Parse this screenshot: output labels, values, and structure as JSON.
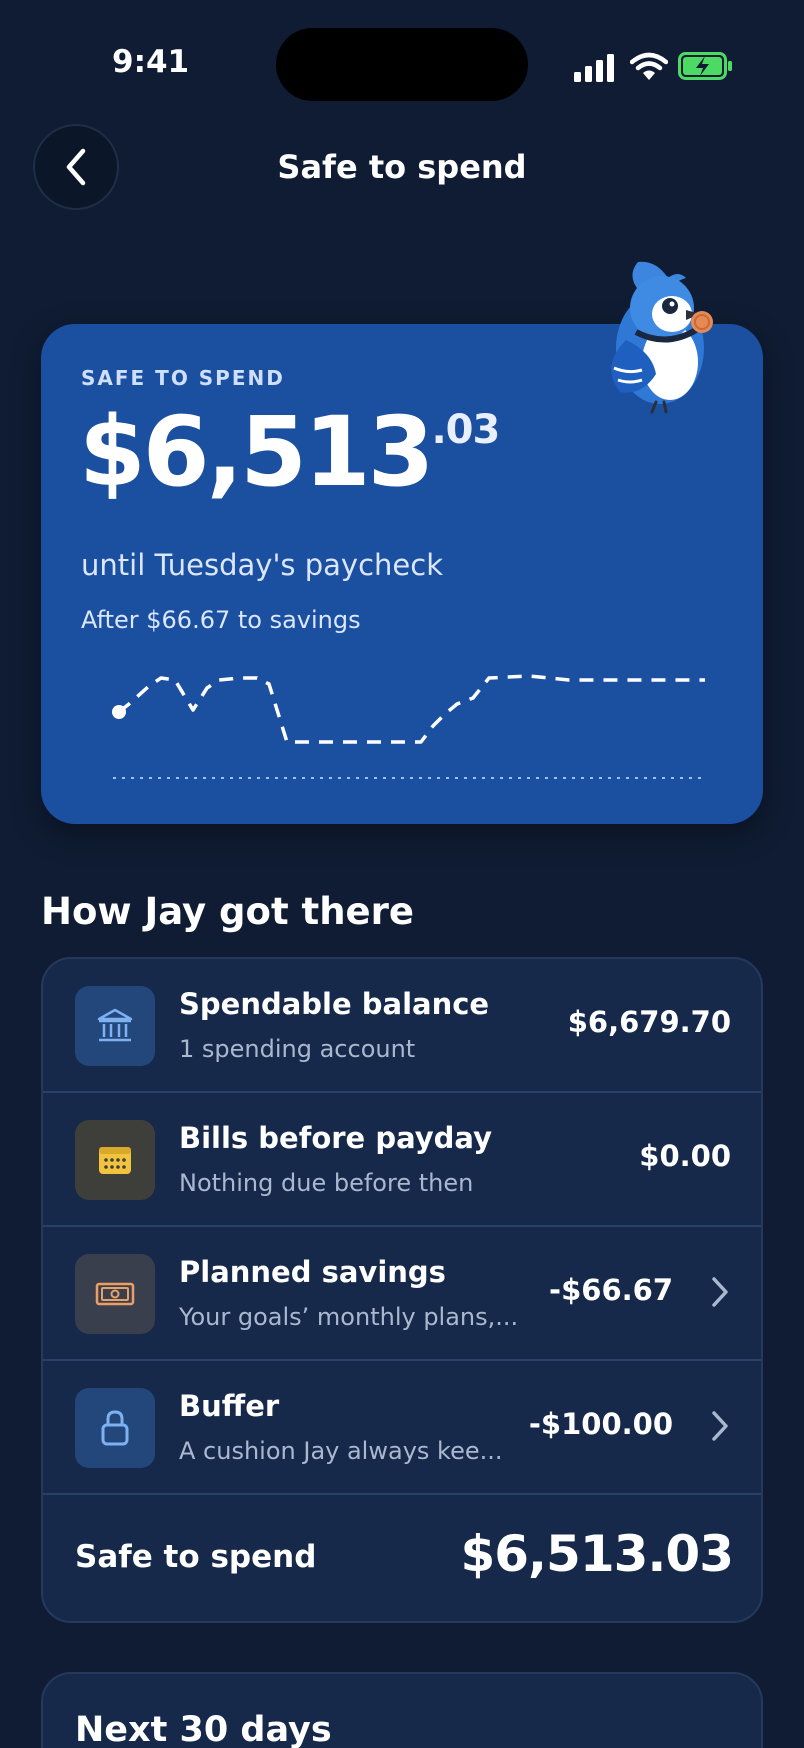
{
  "status_bar": {
    "time": "9:41",
    "icons": [
      "signal-icon",
      "wifi-icon",
      "battery-charging-icon"
    ]
  },
  "header": {
    "title": "Safe to spend",
    "back_icon": "chevron-left-icon"
  },
  "hero": {
    "eyebrow": "SAFE TO SPEND",
    "amount_main": "$6,513",
    "amount_cents": ".03",
    "subtitle": "until Tuesday's paycheck",
    "savings_note": "After $66.67 to savings",
    "mascot": "blue-jay-mascot"
  },
  "breakdown": {
    "heading": "How Jay got there",
    "rows": [
      {
        "icon": "bank-icon",
        "title": "Spendable balance",
        "subtitle": "1 spending account",
        "amount": "$6,679.70",
        "has_chevron": false
      },
      {
        "icon": "calendar-icon",
        "title": "Bills before payday",
        "subtitle": "Nothing due before then",
        "amount": "$0.00",
        "has_chevron": false
      },
      {
        "icon": "banknote-icon",
        "title": "Planned savings",
        "subtitle": "Your goals’ monthly plans,...",
        "amount": "-$66.67",
        "has_chevron": true
      },
      {
        "icon": "lock-icon",
        "title": "Buffer",
        "subtitle": "A cushion Jay always kee...",
        "amount": "-$100.00",
        "has_chevron": true
      }
    ],
    "total_label": "Safe to spend",
    "total_amount": "$6,513.03"
  },
  "next_section": {
    "title": "Next 30 days"
  },
  "colors": {
    "background": "#0f1c33",
    "hero_card": "#1b4fa0",
    "panel": "#16294a",
    "bank_tile": "#23477a",
    "calendar_tile": "#3e3f3a",
    "calendar_accent": "#f2c43d",
    "banknote_tile": "#3a3f4d",
    "banknote_accent": "#e8a066",
    "lock_tile": "#23477a",
    "lock_accent": "#7eb1f2",
    "battery_green": "#4cd964"
  }
}
